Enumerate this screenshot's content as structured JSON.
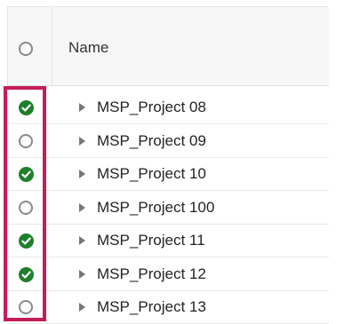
{
  "header": {
    "title": "Name",
    "select_all_checked": false
  },
  "rows": [
    {
      "label": "MSP_Project 08",
      "checked": true
    },
    {
      "label": "MSP_Project 09",
      "checked": false
    },
    {
      "label": "MSP_Project 10",
      "checked": true
    },
    {
      "label": "MSP_Project 100",
      "checked": false
    },
    {
      "label": "MSP_Project 11",
      "checked": true
    },
    {
      "label": "MSP_Project 12",
      "checked": true
    },
    {
      "label": "MSP_Project 13",
      "checked": false
    }
  ],
  "colors": {
    "checked": "#1e7f2b",
    "highlight": "#c41d5a"
  },
  "icons": {
    "checked": "check-circle-icon",
    "unchecked": "empty-circle-icon",
    "expander": "caret-right-icon"
  }
}
